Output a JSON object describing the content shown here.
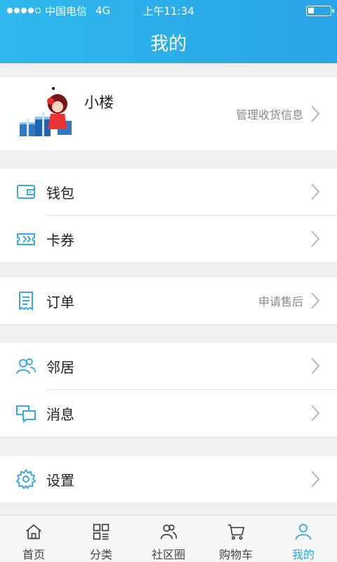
{
  "status_bar": {
    "carrier": "中国电信",
    "network": "4G",
    "time": "上午11:34"
  },
  "header": {
    "title": "我的"
  },
  "profile": {
    "username": "小楼",
    "manage_label": "管理收货信息"
  },
  "menu": {
    "wallet": {
      "label": "钱包",
      "icon": "wallet-icon"
    },
    "coupons": {
      "label": "卡券",
      "icon": "ticket-icon"
    },
    "orders": {
      "label": "订单",
      "extra": "申请售后",
      "icon": "receipt-icon"
    },
    "neighbors": {
      "label": "邻居",
      "icon": "people-icon"
    },
    "messages": {
      "label": "消息",
      "icon": "chat-icon"
    },
    "settings": {
      "label": "设置",
      "icon": "gear-icon"
    }
  },
  "tabbar": {
    "tabs": [
      {
        "label": "首页",
        "icon": "home-icon"
      },
      {
        "label": "分类",
        "icon": "grid-icon"
      },
      {
        "label": "社区圈",
        "icon": "community-icon"
      },
      {
        "label": "购物车",
        "icon": "cart-icon"
      },
      {
        "label": "我的",
        "icon": "user-icon",
        "active": true
      }
    ]
  },
  "colors": {
    "accent": "#2aa6e8",
    "header_gradient_start": "#2fb8ee",
    "header_gradient_end": "#29a4e6",
    "background": "#efefef",
    "icon_blue": "#3aa8e0"
  }
}
